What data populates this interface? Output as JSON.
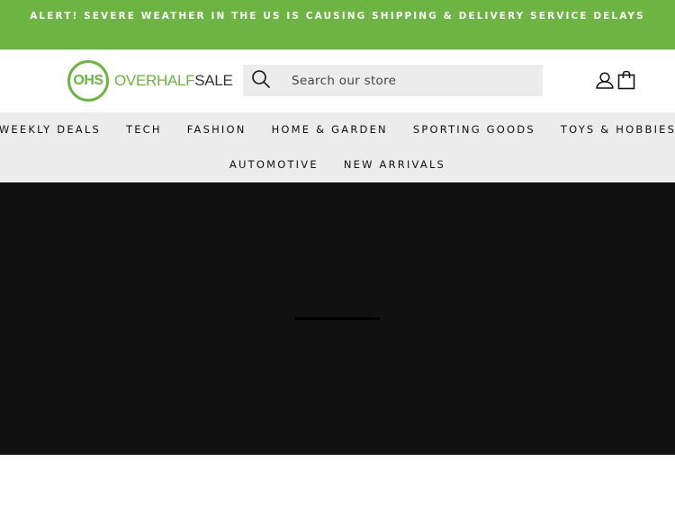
{
  "announcement": {
    "text": "ALERT! SEVERE WEATHER IN THE US IS CAUSING SHIPPING & DELIVERY SERVICE DELAYS"
  },
  "logo": {
    "initials": "OHS",
    "word_part1": "OVERHALF",
    "word_part2": "SALE"
  },
  "search": {
    "placeholder": "Search our store",
    "icon": "search-icon"
  },
  "header_icons": [
    "account-icon",
    "cart-icon"
  ],
  "nav": {
    "row1": [
      "WEEKLY DEALS",
      "TECH",
      "FASHION",
      "HOME & GARDEN",
      "SPORTING GOODS",
      "TOYS & HOBBIES"
    ],
    "row2": [
      "AUTOMOTIVE",
      "NEW ARRIVALS"
    ]
  },
  "colors": {
    "brand_green": "#6cb543",
    "nav_background": "#ececec",
    "hero_background": "#111111"
  }
}
